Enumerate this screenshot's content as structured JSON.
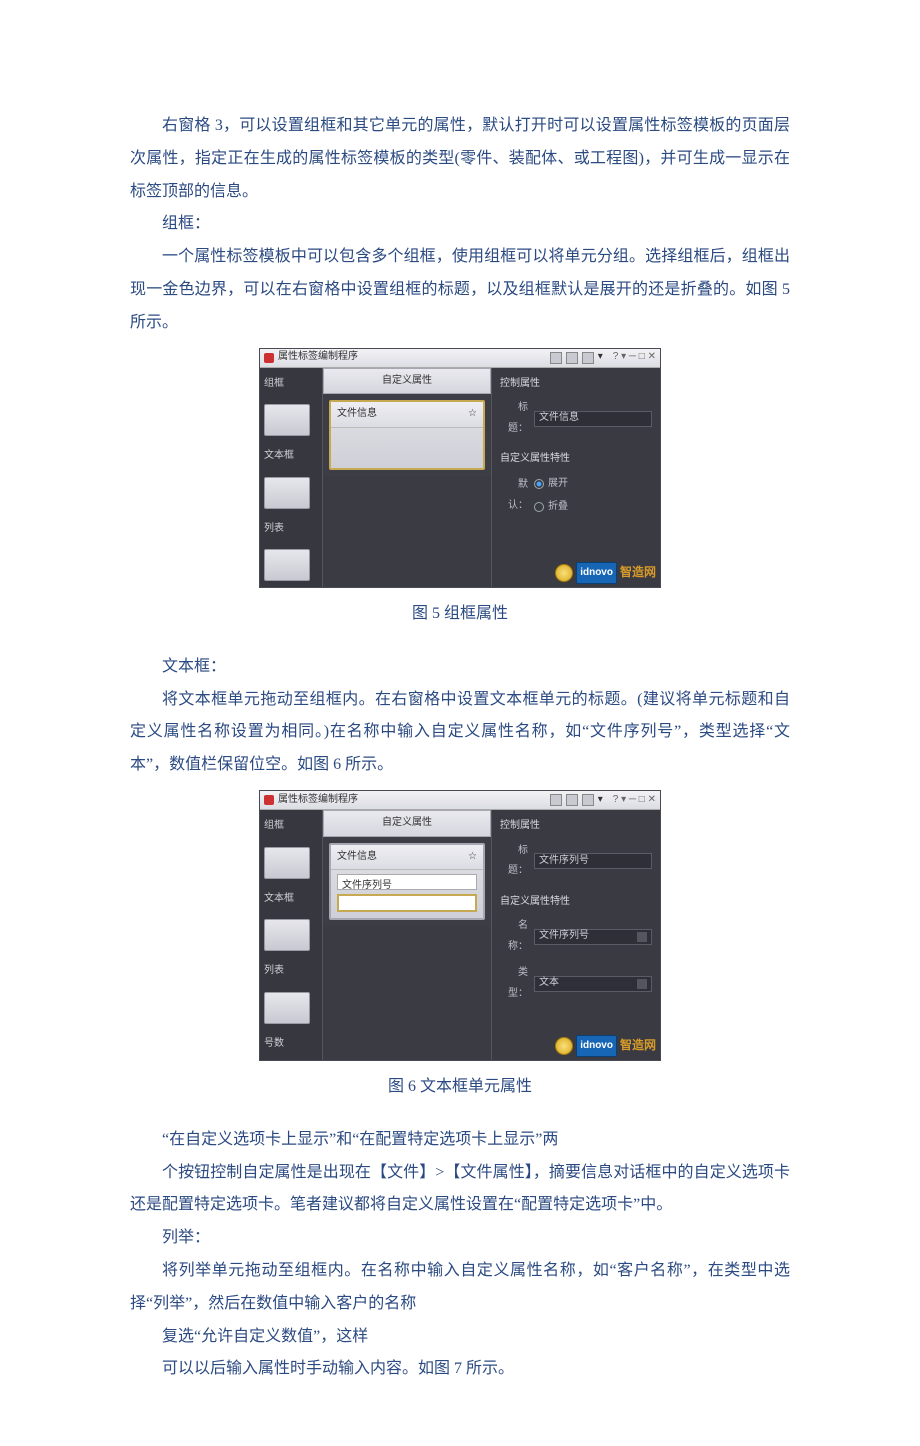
{
  "paragraphs": {
    "p1": "右窗格 3，可以设置组框和其它单元的属性，默认打开时可以设置属性标签模板的页面层次属性，指定正在生成的属性标签模板的类型(零件、装配体、或工程图)，并可生成一显示在标签顶部的信息。",
    "p2": "组框：",
    "p3": "一个属性标签模板中可以包含多个组框，使用组框可以将单元分组。选择组框后，组框出现一金色边界，可以在右窗格中设置组框的标题，以及组框默认是展开的还是折叠的。如图 5 所示。",
    "cap5": "图 5 组框属性",
    "p4": "文本框：",
    "p5": "将文本框单元拖动至组框内。在右窗格中设置文本框单元的标题。(建议将单元标题和自定义属性名称设置为相同。)在名称中输入自定义属性名称，如“文件序列号”，类型选择“文本”，数值栏保留位空。如图 6 所示。",
    "cap6": "图 6 文本框单元属性",
    "p6": "“在自定义选项卡上显示”和“在配置特定选项卡上显示”两",
    "p7": "个按钮控制自定属性是出现在【文件】>【文件属性】，摘要信息对话框中的自定义选项卡还是配置特定选项卡。笔者建议都将自定义属性设置在“配置特定选项卡”中。",
    "p8": "列举：",
    "p9": "将列举单元拖动至组框内。在名称中输入自定义属性名称，如“客户名称”，在类型中选择“列举”，然后在数值中输入客户的名称",
    "p10": "复选“允许自定义数值”，这样",
    "p11": "可以以后输入属性时手动输入内容。如图 7 所示。"
  },
  "fig5": {
    "win_title": "属性标签编制程序",
    "win_controls": "?  ▾  ─  □  ✕",
    "palette": {
      "groupbox": "组框",
      "textbox": "文本框",
      "list": "列表"
    },
    "mid_header": "自定义属性",
    "group_title": "文件信息",
    "collapse_glyph": "☆",
    "right": {
      "section1": "控制属性",
      "label_title": "标题：",
      "title_value": "文件信息",
      "section2": "自定义属性特性",
      "label_default": "默认：",
      "radio_expand": "展开",
      "radio_collapse": "折叠"
    },
    "watermark": {
      "brand": "idnovo",
      "cn": "智造网"
    }
  },
  "fig6": {
    "win_title": "属性标签编制程序",
    "win_controls": "?  ▾  ─  □  ✕",
    "palette": {
      "groupbox": "组框",
      "textbox": "文本框",
      "list": "列表",
      "number": "号数"
    },
    "mid_header": "自定义属性",
    "group_title": "文件信息",
    "collapse_glyph": "☆",
    "field_label": "文件序列号",
    "right": {
      "section1": "控制属性",
      "label_title": "标题：",
      "title_value": "文件序列号",
      "section2": "自定义属性特性",
      "label_name": "名称：",
      "name_value": "文件序列号",
      "label_type": "类型：",
      "type_value": "文本"
    },
    "watermark": {
      "brand": "idnovo",
      "cn": "智造网"
    }
  }
}
